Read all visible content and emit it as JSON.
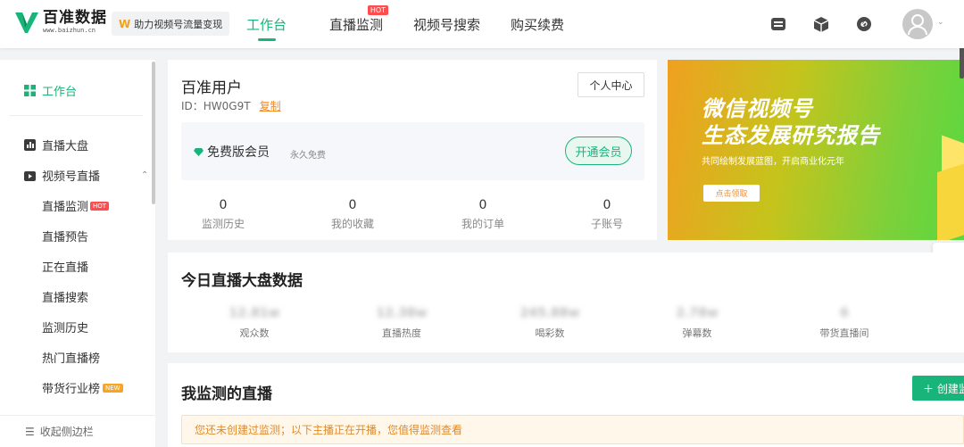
{
  "header": {
    "logo_name": "百准数据",
    "logo_url": "www.baizhun.cn",
    "slogan": "助力视频号流量变现",
    "nav": [
      {
        "label": "工作台",
        "active": true
      },
      {
        "label": "直播监测",
        "hot": "HOT"
      },
      {
        "label": "视频号搜索"
      },
      {
        "label": "购买续费"
      }
    ]
  },
  "sidebar": {
    "workbench": "工作台",
    "live_dashboard": "直播大盘",
    "channel_live": "视频号直播",
    "subs": [
      {
        "label": "直播监测",
        "badge": "HOT"
      },
      {
        "label": "直播预告"
      },
      {
        "label": "正在直播"
      },
      {
        "label": "直播搜索"
      },
      {
        "label": "监测历史"
      },
      {
        "label": "热门直播榜"
      },
      {
        "label": "带货行业榜",
        "badge": "NEW"
      }
    ],
    "collapse": "收起侧边栏"
  },
  "user": {
    "name": "百准用户",
    "id_text": "ID：HW0G9T",
    "copy": "复制",
    "center_btn": "个人中心",
    "member_label": "免费版会员",
    "member_sub": "永久免费",
    "open_btn": "开通会员",
    "stats": [
      {
        "value": "0",
        "label": "监测历史"
      },
      {
        "value": "0",
        "label": "我的收藏"
      },
      {
        "value": "0",
        "label": "我的订单"
      },
      {
        "value": "0",
        "label": "子账号"
      }
    ]
  },
  "banner": {
    "title_line1": "微信视频号",
    "title_line2": "生态发展研究报告",
    "subtitle": "共同绘制发展蓝图，开启商业化元年",
    "button": "点击领取"
  },
  "today": {
    "title": "今日直播大盘数据",
    "stats": [
      {
        "value": "12.81w",
        "label": "观众数"
      },
      {
        "value": "12.38w",
        "label": "直播热度"
      },
      {
        "value": "245.88w",
        "label": "喝彩数"
      },
      {
        "value": "2.78w",
        "label": "弹幕数"
      },
      {
        "value": "6",
        "label": "带货直播间"
      }
    ]
  },
  "monitored": {
    "title": "我监测的直播",
    "create_btn": "＋ 创建监测",
    "notice": "您还未创建过监测；以下主播正在开播，您值得监测查看"
  },
  "colors": {
    "accent": "#19b47a",
    "hot": "#ff4d4f",
    "warn": "#f08c2a"
  }
}
